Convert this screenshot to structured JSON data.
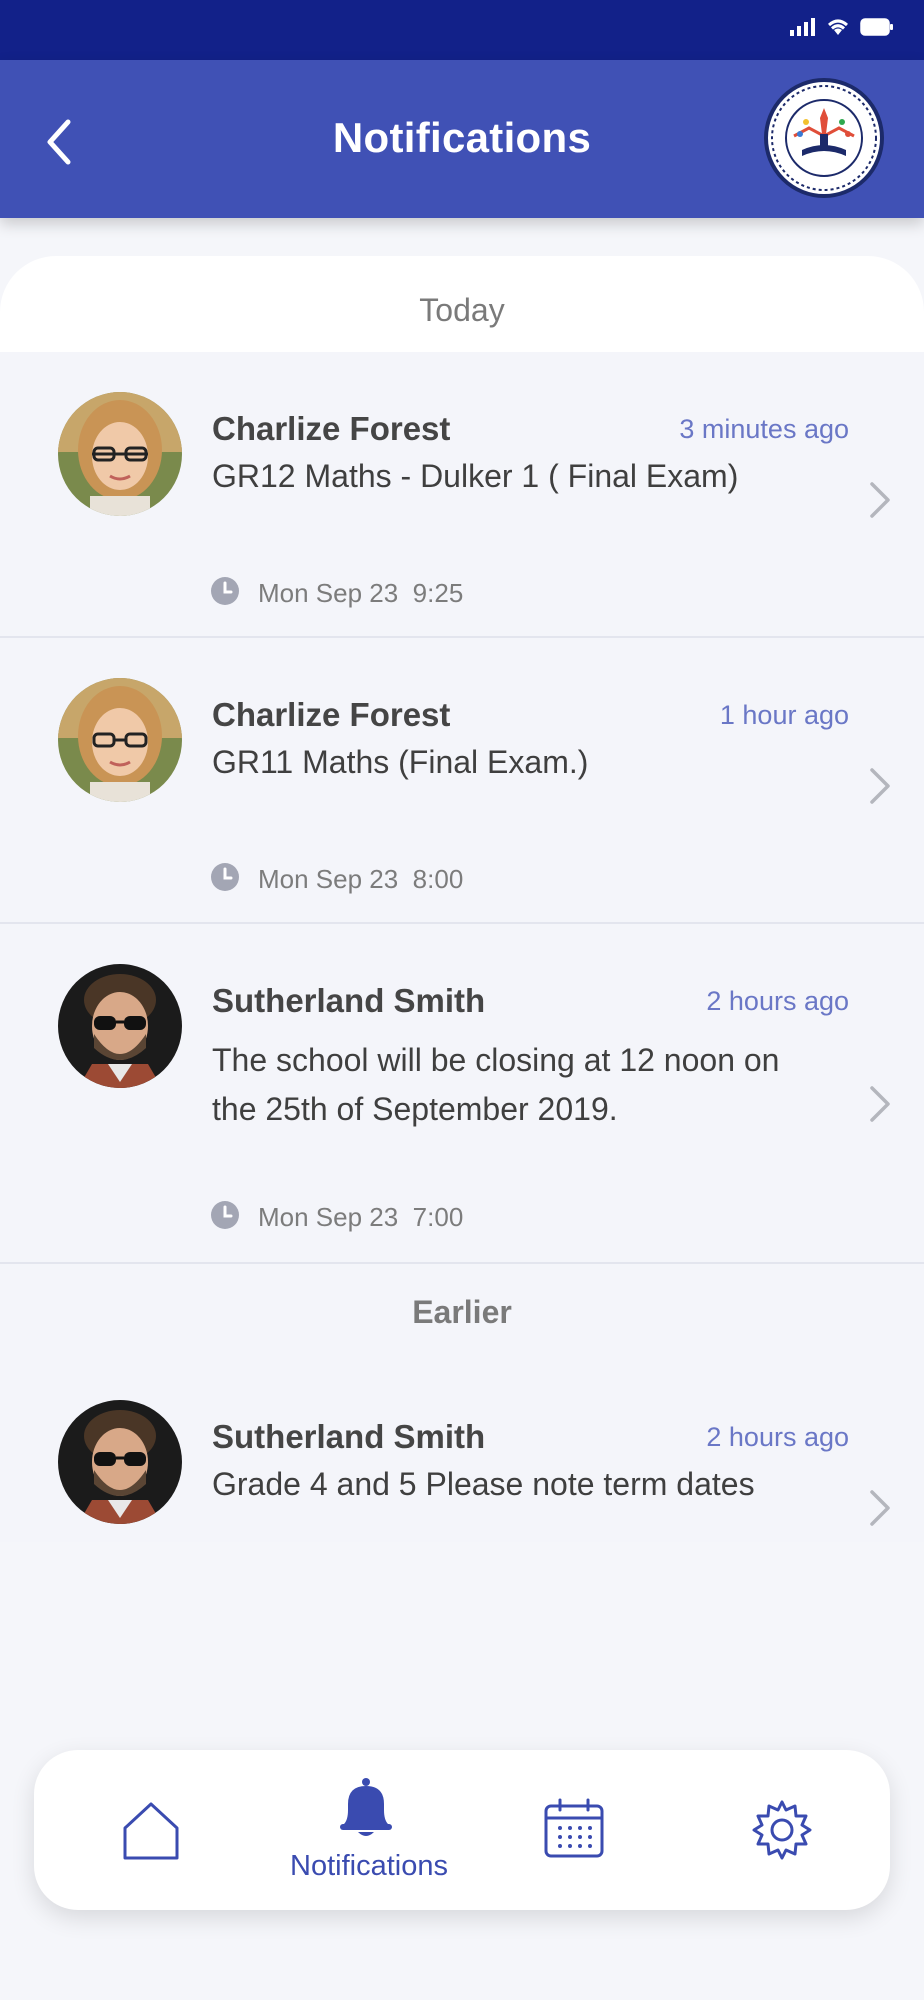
{
  "header": {
    "title": "Notifications"
  },
  "sections": {
    "today": "Today",
    "earlier": "Earlier"
  },
  "notifications": [
    {
      "sender": "Charlize Forest",
      "ago": "3 minutes ago",
      "message": "GR12 Maths - Dulker 1 ( Final Exam)",
      "date": "Mon Sep 23",
      "time": "9:25"
    },
    {
      "sender": "Charlize Forest",
      "ago": "1 hour ago",
      "message": "GR11 Maths (Final Exam.)",
      "date": "Mon Sep 23",
      "time": "8:00"
    },
    {
      "sender": "Sutherland Smith",
      "ago": "2 hours ago",
      "message": "The school will be closing at 12 noon on the 25th of September 2019.",
      "date": "Mon Sep 23",
      "time": "7:00"
    },
    {
      "sender": "Sutherland Smith",
      "ago": "2 hours ago",
      "message": "Grade 4 and 5 Please note term dates"
    }
  ],
  "tabbar": {
    "active_label": "Notifications"
  },
  "colors": {
    "header": "#4051b5",
    "status_bar": "#122189",
    "accent": "#3a4bb0",
    "ago_text": "#6a77c6"
  },
  "icons": [
    "back-chevron-icon",
    "school-logo",
    "clock-icon",
    "chevron-right-icon",
    "home-icon",
    "bell-icon",
    "calendar-icon",
    "gear-icon",
    "signal-icon",
    "wifi-icon",
    "battery-icon"
  ]
}
